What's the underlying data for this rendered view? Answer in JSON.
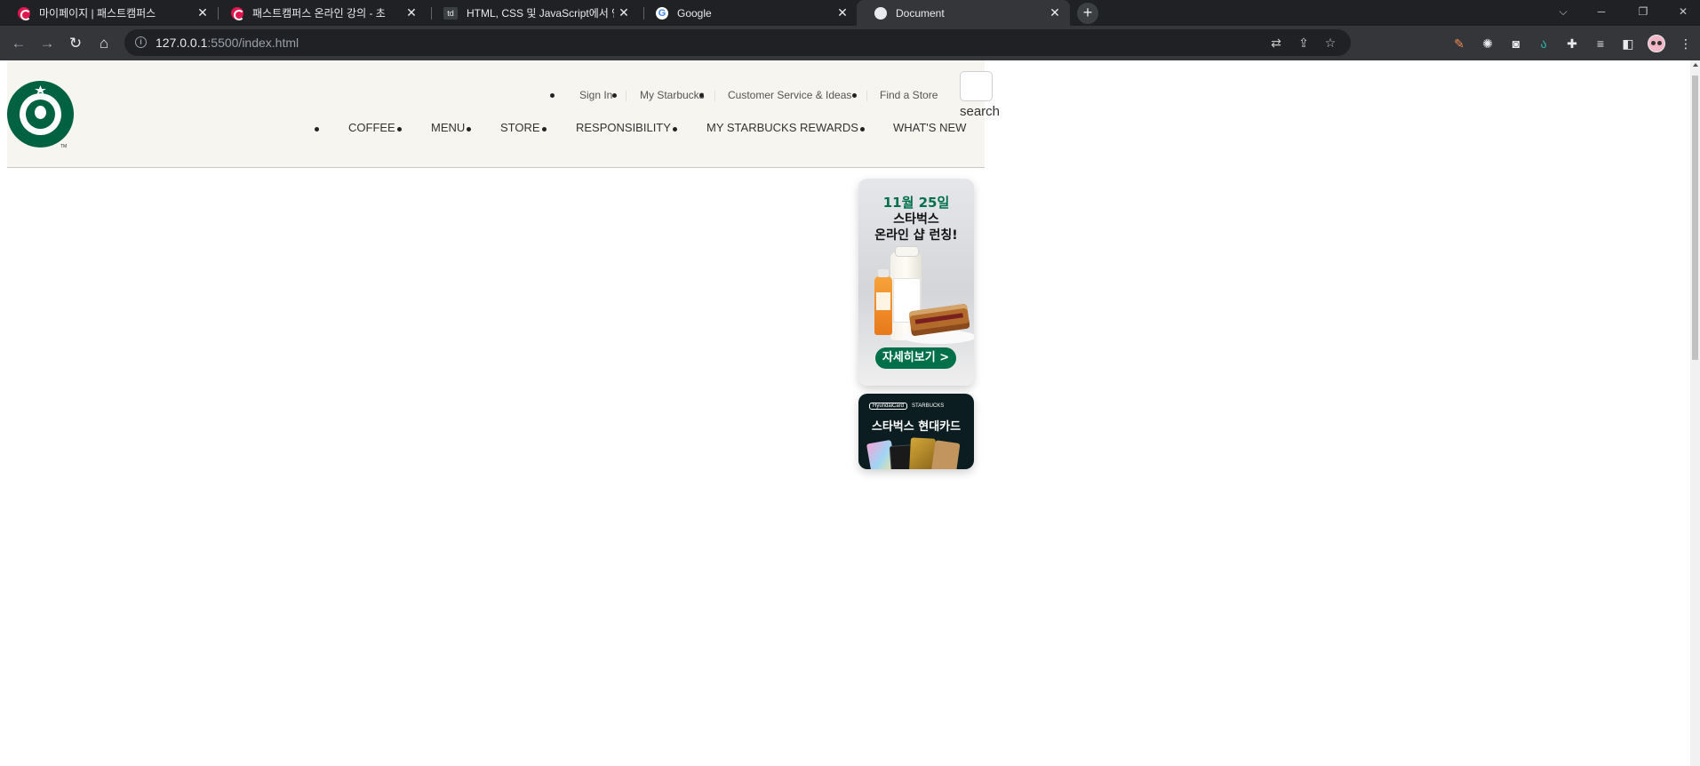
{
  "browser": {
    "tabs": [
      {
        "title": "마이페이지 | 패스트캠퍼스",
        "favicon": "fastcampus-icon"
      },
      {
        "title": "패스트캠퍼스 온라인 강의 - 초",
        "favicon": "fastcampus-icon"
      },
      {
        "title": "HTML, CSS 및 JavaScript에서 인",
        "favicon": "td"
      },
      {
        "title": "Google",
        "favicon": "G"
      },
      {
        "title": "Document",
        "favicon": "globe-icon",
        "active": true
      }
    ],
    "new_tab": "+",
    "address": {
      "host": "127.0.0.1",
      "rest": ":5500/index.html"
    }
  },
  "header": {
    "sub_menu": [
      "Sign In",
      "My Starbucks",
      "Customer Service & Ideas",
      "Find a Store"
    ],
    "main_menu": [
      "COFFEE",
      "MENU",
      "STORE",
      "RESPONSIBILITY",
      "MY STARBUCKS REWARDS",
      "WHAT'S NEW"
    ],
    "search_label": "search",
    "logo_tm": "TM"
  },
  "badges": [
    {
      "date": "11월 25일",
      "title_line1": "스타벅스",
      "title_line2": "온라인 샵 런칭!",
      "button": "자세히보기 >"
    },
    {
      "brand_left": "HyundaiCard",
      "brand_right": "STARBUCKS",
      "title": "스타벅스 현대카드"
    }
  ],
  "colors": {
    "brand_green": "#00704a",
    "header_bg": "#f6f5ef",
    "chrome_dark": "#202124"
  }
}
